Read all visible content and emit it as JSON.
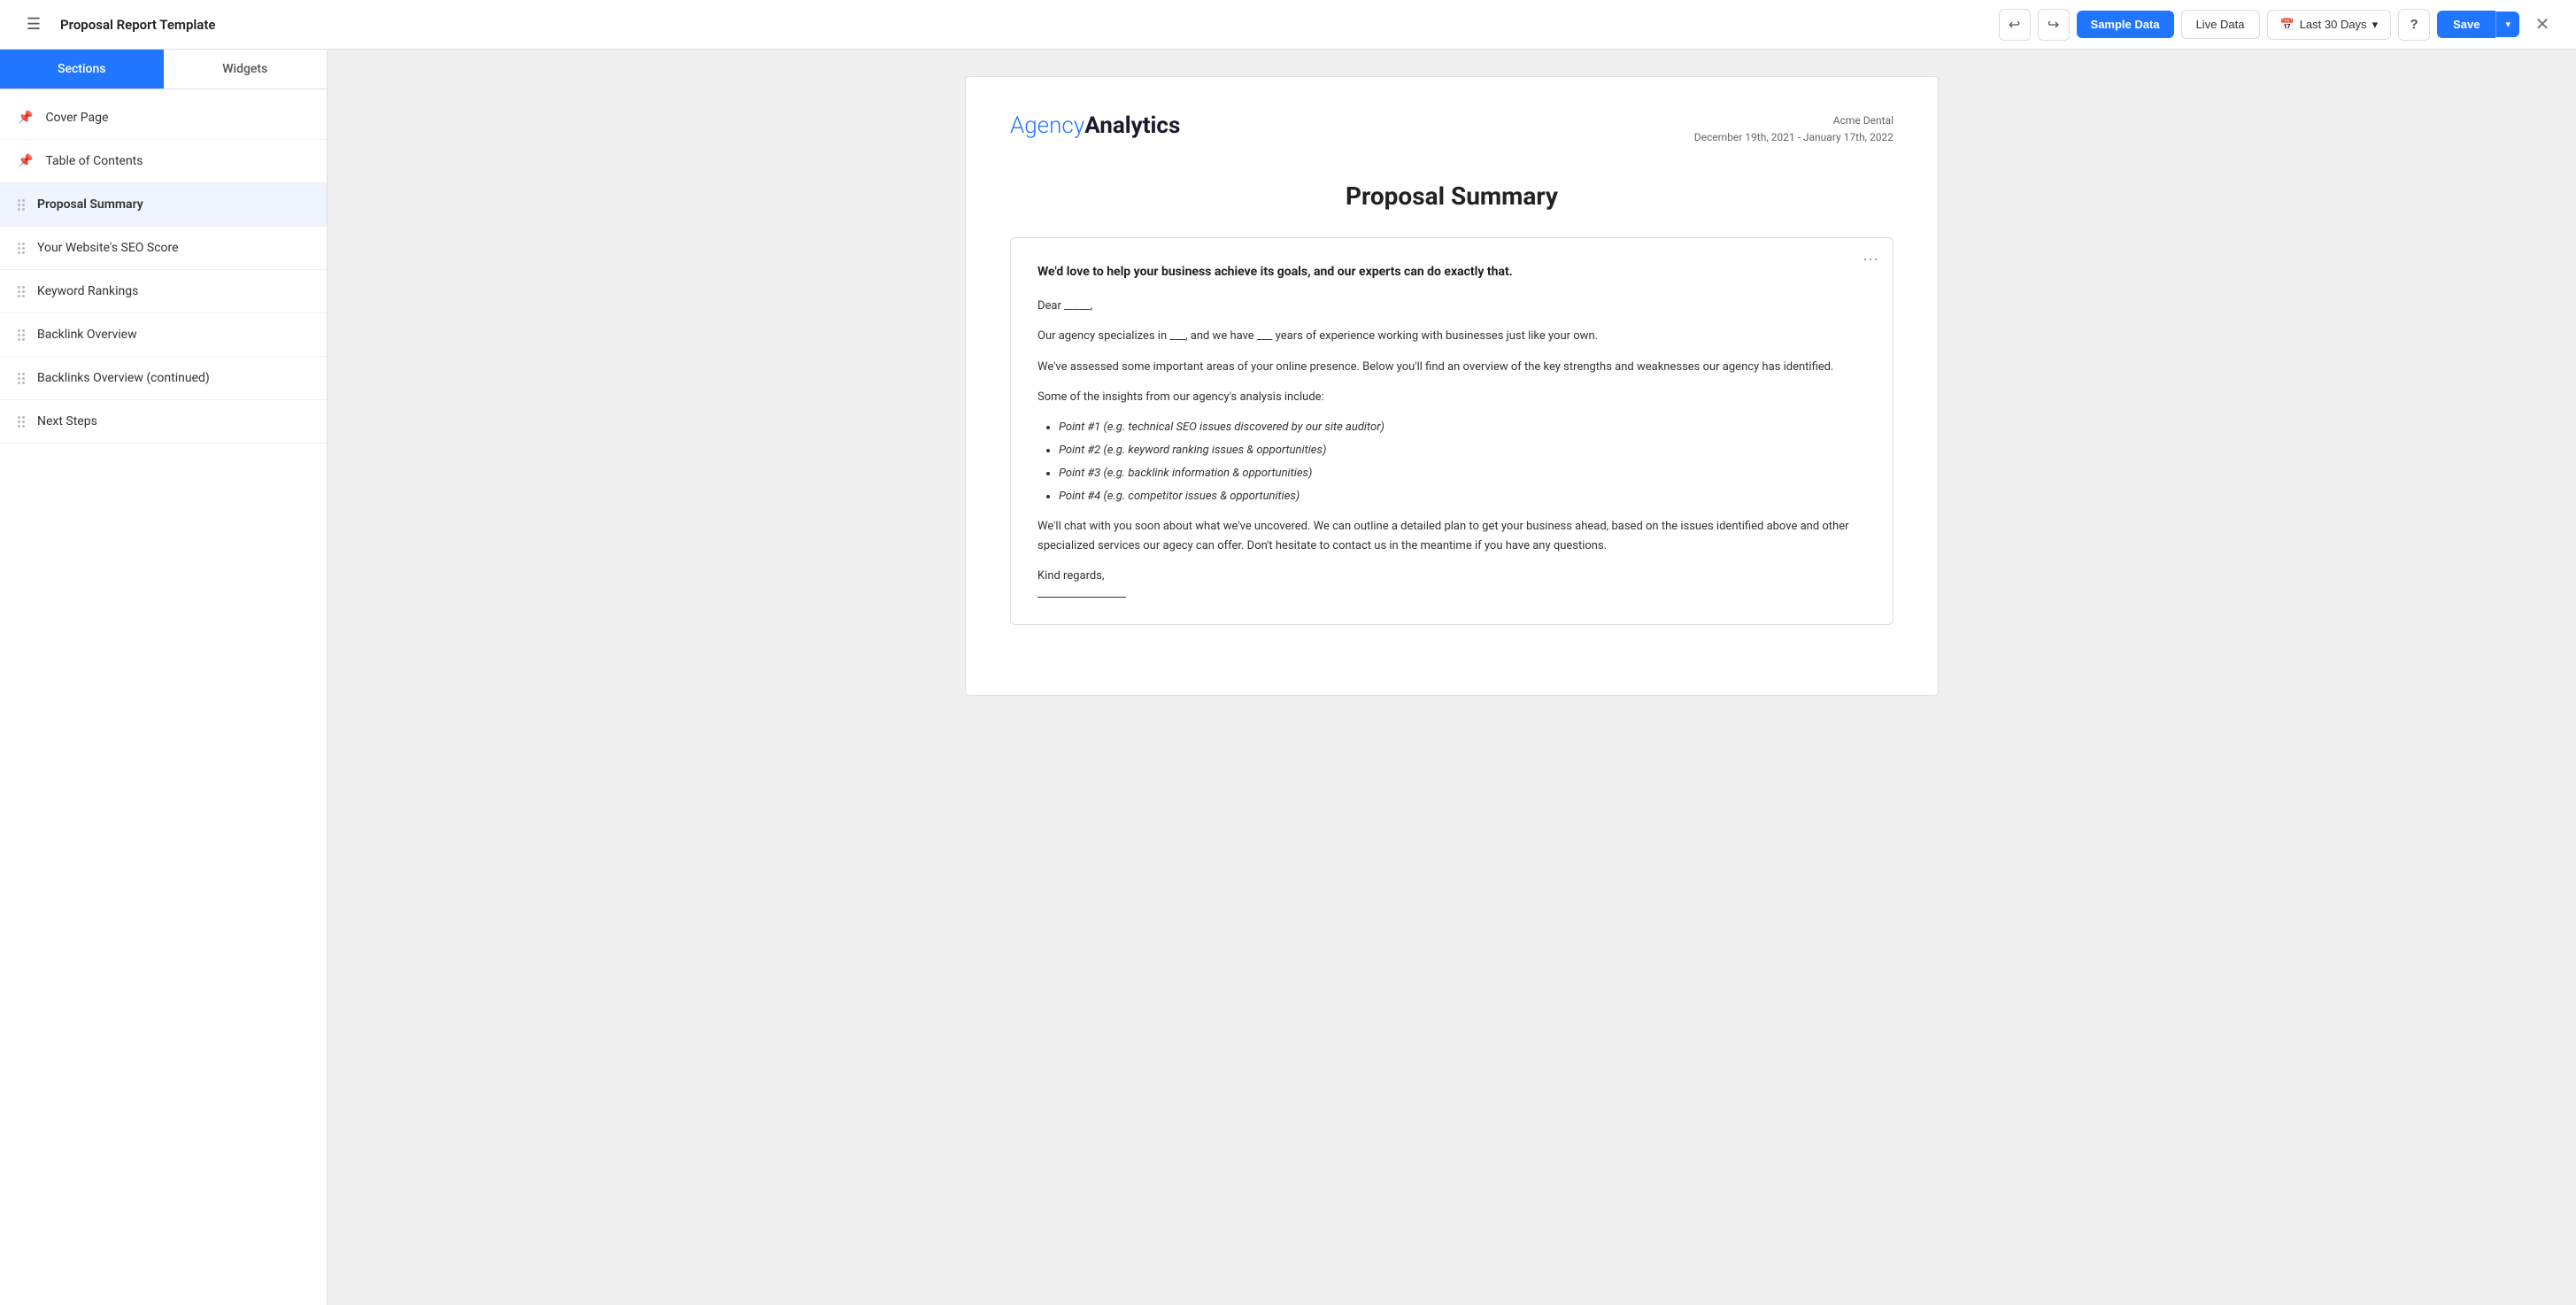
{
  "app": {
    "title": "Proposal Report Template",
    "hamburger": "☰"
  },
  "nav": {
    "undo_icon": "↩",
    "redo_icon": "↪",
    "sample_data_label": "Sample Data",
    "live_data_label": "Live Data",
    "date_range_label": "Last 30 Days",
    "date_icon": "📅",
    "help_label": "?",
    "save_label": "Save",
    "save_chevron": "▾",
    "close_icon": "✕"
  },
  "sidebar": {
    "tab_sections": "Sections",
    "tab_widgets": "Widgets",
    "items": [
      {
        "id": "cover-page",
        "label": "Cover Page",
        "type": "pin"
      },
      {
        "id": "table-of-contents",
        "label": "Table of Contents",
        "type": "pin"
      },
      {
        "id": "proposal-summary",
        "label": "Proposal Summary",
        "type": "drag",
        "active": true
      },
      {
        "id": "seo-score",
        "label": "Your Website's SEO Score",
        "type": "drag"
      },
      {
        "id": "keyword-rankings",
        "label": "Keyword Rankings",
        "type": "drag"
      },
      {
        "id": "backlink-overview",
        "label": "Backlink Overview",
        "type": "drag"
      },
      {
        "id": "backlinks-continued",
        "label": "Backlinks Overview (continued)",
        "type": "drag"
      },
      {
        "id": "next-steps",
        "label": "Next Steps",
        "type": "drag"
      }
    ]
  },
  "report": {
    "brand_agency": "Agency",
    "brand_analytics": "Analytics",
    "client_name": "Acme Dental",
    "date_range": "December 19th, 2021 - January 17th, 2022",
    "title": "Proposal Summary",
    "card": {
      "header": "We'd love to help your business achieve its goals, and our experts can do exactly that.",
      "greeting": "Dear _____,",
      "para1": "Our agency specializes in ___, and we have ___ years of experience working with businesses just like your own.",
      "para2": "We've assessed some important areas of your online presence. Below you'll find an overview of the key strengths and weaknesses our agency has identified.",
      "insights_intro": "Some of the insights from our agency's analysis include:",
      "bullet_items": [
        "Point #1 (e.g. technical SEO issues discovered by our site auditor)",
        "Point #2 (e.g. keyword ranking issues & opportunities)",
        "Point #3 (e.g. backlink information & opportunities)",
        "Point #4 (e.g. competitor issues & opportunities)"
      ],
      "closing_para": "We'll chat with you soon about what we've uncovered. We can outline a detailed plan to get your business ahead, based on the issues identified above and other specialized services our agecy can offer. Don't hesitate to contact us in the meantime if you have any questions.",
      "sign_off": "Kind regards,"
    }
  }
}
